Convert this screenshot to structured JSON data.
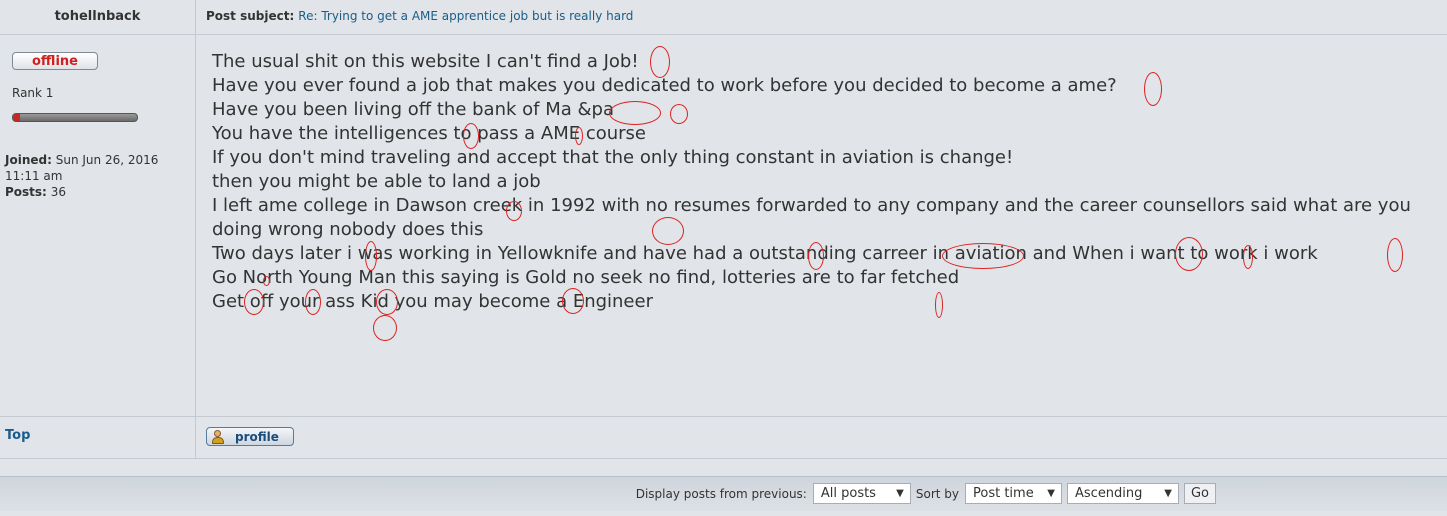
{
  "post": {
    "author": "tohellnback",
    "subject_label": "Post subject:",
    "subject": "Re: Trying to get a AME apprentice job but is really hard",
    "status_badge": "offline",
    "rank": "Rank 1",
    "rank_progress_percent": 6,
    "joined_label": "Joined:",
    "joined_value": "Sun Jun 26, 2016 11:11 am",
    "posts_label": "Posts:",
    "posts_value": "36",
    "body_lines": [
      "The usual shit on this website I can't find a Job!",
      "Have you ever found a job that makes you dedicated to work before you decided to become a ame?",
      "Have you been living off the bank of Ma &pa",
      "You have the intelligences to pass a AME course",
      "If you don't mind traveling and accept that the only thing constant in aviation is change!",
      "then you might be able to land a job",
      "I left ame college in Dawson creek in 1992 with no resumes forwarded to any company and the career counsellors said what are you doing wrong nobody does this",
      "Two days later i was working in Yellowknife and have had a outstanding carreer in aviation and When i want to work i work",
      "Go North Young Man this saying is Gold no seek no find, lotteries are to far fetched",
      "Get off your ass Kid you may become a Engineer"
    ],
    "annotation_color": "#dd2222"
  },
  "actions": {
    "top_link": "Top",
    "profile_button": "profile"
  },
  "footer": {
    "display_label": "Display posts from previous:",
    "display_value": "All posts",
    "sort_label": "Sort by",
    "sort_value": "Post time",
    "order_value": "Ascending",
    "go_label": "Go"
  }
}
